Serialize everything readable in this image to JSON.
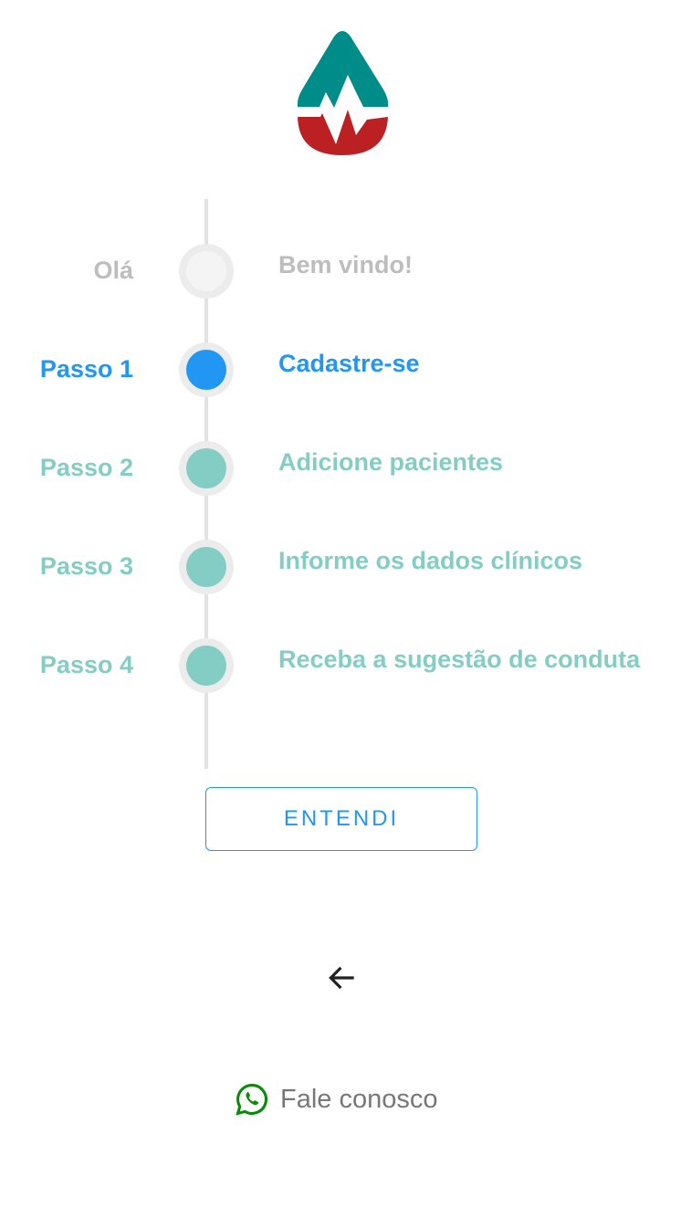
{
  "colors": {
    "teal": "#008d8a",
    "red": "#bb2023",
    "active": "#2196f3",
    "pending": "#84cdc4",
    "done": "#bdbdbd"
  },
  "steps": [
    {
      "label": "Olá",
      "text": "Bem vindo!",
      "state": "done"
    },
    {
      "label": "Passo 1",
      "text": "Cadastre-se",
      "state": "active"
    },
    {
      "label": "Passo 2",
      "text": "Adicione pacientes",
      "state": "pending"
    },
    {
      "label": "Passo 3",
      "text": "Informe os dados clínicos",
      "state": "pending"
    },
    {
      "label": "Passo 4",
      "text": "Receba a sugestão de conduta",
      "state": "pending"
    }
  ],
  "button": {
    "label": "ENTENDI"
  },
  "back": {
    "icon": "arrow-left-icon"
  },
  "contact": {
    "label": "Fale conosco",
    "icon": "whatsapp-icon"
  }
}
